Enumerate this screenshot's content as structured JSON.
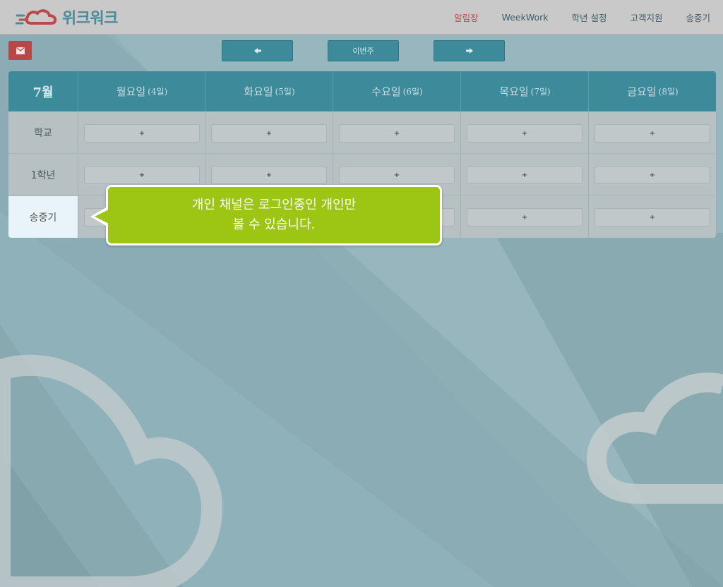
{
  "header": {
    "logo_text": "위크워크",
    "nav": [
      {
        "label": "알림장",
        "active": true
      },
      {
        "label": "WeekWork",
        "active": false
      },
      {
        "label": "학년 설정",
        "active": false
      },
      {
        "label": "고객지원",
        "active": false
      },
      {
        "label": "송중기",
        "active": false
      }
    ]
  },
  "toolbar": {
    "mail_icon": "envelope-icon",
    "prev_icon": "arrow-left-icon",
    "this_week_label": "이번주",
    "next_icon": "arrow-right-icon"
  },
  "calendar": {
    "month": "7월",
    "days": [
      {
        "name": "월요일",
        "date": "(4일)"
      },
      {
        "name": "화요일",
        "date": "(5일)"
      },
      {
        "name": "수요일",
        "date": "(6일)"
      },
      {
        "name": "목요일",
        "date": "(7일)"
      },
      {
        "name": "금요일",
        "date": "(8일)"
      }
    ],
    "rows": [
      {
        "label": "학교"
      },
      {
        "label": "1학년"
      },
      {
        "label": "송중기"
      }
    ],
    "add_label": "+"
  },
  "tooltip": {
    "line1": "개인 채널은 로그인중인 개인만",
    "line2": "볼 수 있습니다."
  },
  "colors": {
    "brand_red": "#b84a4a",
    "brand_teal": "#3d8b9a",
    "tooltip_green": "#9dc614"
  }
}
